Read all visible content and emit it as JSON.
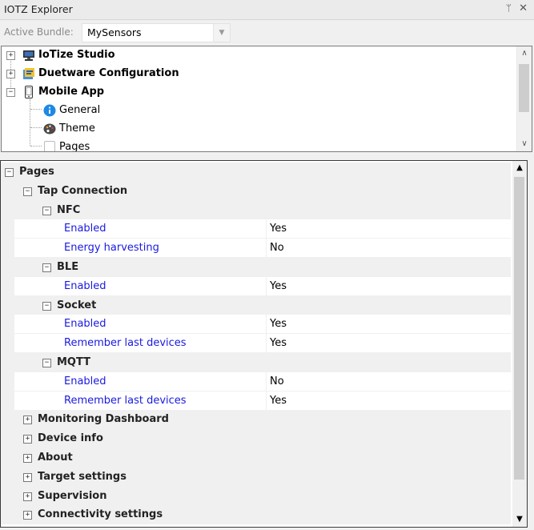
{
  "window": {
    "title": "IOTZ Explorer",
    "pin_glyph": "ᛘ",
    "close_glyph": "✕"
  },
  "bundle": {
    "label": "Active Bundle:",
    "value": "MySensors"
  },
  "tree": {
    "nodes": [
      {
        "label": "IoTize Studio",
        "icon": "monitor-icon",
        "expanded": false
      },
      {
        "label": "Duetware Configuration",
        "icon": "config-icon",
        "expanded": false
      },
      {
        "label": "Mobile App",
        "icon": "phone-icon",
        "expanded": true
      },
      {
        "label": "General",
        "icon": "info-icon"
      },
      {
        "label": "Theme",
        "icon": "palette-icon"
      },
      {
        "label": "Pages",
        "icon": "page-icon"
      }
    ]
  },
  "grid": {
    "rows": [
      {
        "kind": "cat",
        "level": 0,
        "label": "Pages",
        "expanded": true
      },
      {
        "kind": "cat",
        "level": 1,
        "label": "Tap Connection",
        "expanded": true
      },
      {
        "kind": "cat",
        "level": 2,
        "label": "NFC",
        "expanded": true
      },
      {
        "kind": "prop",
        "name": "Enabled",
        "value": "Yes"
      },
      {
        "kind": "prop",
        "name": "Energy harvesting",
        "value": "No"
      },
      {
        "kind": "cat",
        "level": 2,
        "label": "BLE",
        "expanded": true
      },
      {
        "kind": "prop",
        "name": "Enabled",
        "value": "Yes"
      },
      {
        "kind": "cat",
        "level": 2,
        "label": "Socket",
        "expanded": true
      },
      {
        "kind": "prop",
        "name": "Enabled",
        "value": "Yes"
      },
      {
        "kind": "prop",
        "name": "Remember last devices",
        "value": "Yes"
      },
      {
        "kind": "cat",
        "level": 2,
        "label": "MQTT",
        "expanded": true
      },
      {
        "kind": "prop",
        "name": "Enabled",
        "value": "No"
      },
      {
        "kind": "prop",
        "name": "Remember last devices",
        "value": "Yes"
      },
      {
        "kind": "cat",
        "level": 1,
        "label": "Monitoring Dashboard",
        "expanded": false
      },
      {
        "kind": "cat",
        "level": 1,
        "label": "Device info",
        "expanded": false
      },
      {
        "kind": "cat",
        "level": 1,
        "label": "About",
        "expanded": false
      },
      {
        "kind": "cat",
        "level": 1,
        "label": "Target settings",
        "expanded": false
      },
      {
        "kind": "cat",
        "level": 1,
        "label": "Supervision",
        "expanded": false
      },
      {
        "kind": "cat",
        "level": 1,
        "label": "Connectivity settings",
        "expanded": false
      }
    ]
  },
  "colors": {
    "property_name": "#1a1ae0",
    "category_bg": "#f0f0f0"
  }
}
